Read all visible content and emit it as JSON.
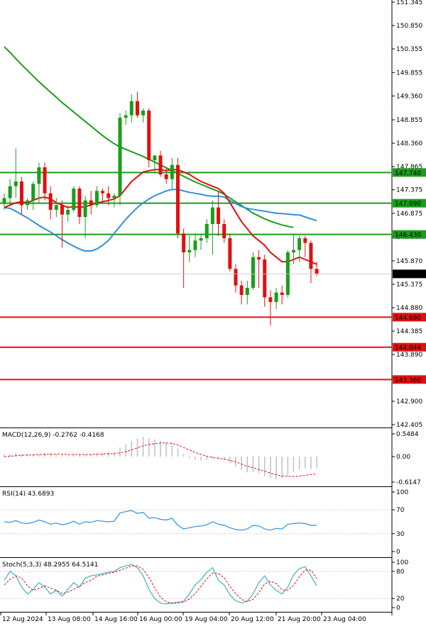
{
  "chart_data": {
    "type": "candlestick",
    "main": {
      "price_axis": [
        "151.345",
        "150.850",
        "150.355",
        "149.855",
        "149.360",
        "148.855",
        "148.360",
        "147.865",
        "147.375",
        "146.875",
        "146.380",
        "145.870",
        "145.375",
        "144.880",
        "144.385",
        "143.890",
        "143.395",
        "142.900",
        "142.405"
      ],
      "ylim": [
        142.405,
        151.345
      ],
      "levels": [
        {
          "value": 147.74,
          "label": "147.740",
          "color": "#1a9e1a"
        },
        {
          "value": 147.09,
          "label": "147.090",
          "color": "#1a9e1a"
        },
        {
          "value": 146.43,
          "label": "146.430",
          "color": "#1a9e1a"
        },
        {
          "value": 144.68,
          "label": "144.680",
          "color": "#e01010"
        },
        {
          "value": 144.044,
          "label": "144.044",
          "color": "#e01010"
        },
        {
          "value": 143.36,
          "label": "143.360",
          "color": "#e01010"
        }
      ],
      "current_price": {
        "value": 145.595,
        "label": "145.595"
      },
      "candles": [
        [
          147.1,
          147.3,
          146.95,
          147.2
        ],
        [
          147.2,
          147.6,
          147.05,
          147.45
        ],
        [
          147.45,
          148.25,
          147.2,
          147.55
        ],
        [
          147.55,
          147.65,
          146.85,
          147.05
        ],
        [
          147.05,
          147.2,
          146.95,
          147.15
        ],
        [
          147.15,
          147.55,
          146.95,
          147.5
        ],
        [
          147.5,
          147.95,
          147.1,
          147.85
        ],
        [
          147.85,
          147.95,
          147.15,
          147.3
        ],
        [
          147.3,
          147.45,
          146.75,
          146.95
        ],
        [
          146.95,
          147.2,
          146.8,
          147.05
        ],
        [
          147.05,
          147.15,
          146.15,
          146.85
        ],
        [
          146.85,
          147.05,
          146.7,
          146.95
        ],
        [
          146.95,
          147.45,
          146.9,
          147.4
        ],
        [
          147.4,
          147.45,
          146.65,
          146.8
        ],
        [
          146.8,
          147.25,
          146.35,
          147.15
        ],
        [
          147.15,
          147.35,
          146.85,
          147.05
        ],
        [
          147.05,
          147.45,
          147.0,
          147.35
        ],
        [
          147.35,
          147.4,
          147.1,
          147.3
        ],
        [
          147.3,
          147.45,
          147.05,
          147.2
        ],
        [
          147.2,
          147.3,
          147.0,
          147.25
        ],
        [
          147.25,
          149.0,
          147.05,
          148.9
        ],
        [
          148.9,
          149.05,
          148.75,
          148.95
        ],
        [
          148.95,
          149.4,
          148.8,
          149.25
        ],
        [
          149.25,
          149.45,
          148.9,
          148.95
        ],
        [
          148.95,
          149.1,
          148.8,
          149.05
        ],
        [
          149.05,
          149.1,
          147.85,
          148.0
        ],
        [
          148.0,
          148.1,
          147.75,
          148.1
        ],
        [
          148.1,
          148.2,
          147.65,
          147.7
        ],
        [
          147.7,
          147.85,
          147.5,
          147.6
        ],
        [
          147.6,
          148.05,
          147.4,
          147.9
        ],
        [
          147.9,
          148.05,
          146.35,
          146.45
        ],
        [
          146.45,
          146.55,
          145.3,
          146.05
        ],
        [
          146.05,
          146.4,
          145.85,
          146.1
        ],
        [
          146.1,
          146.45,
          145.95,
          146.3
        ],
        [
          146.3,
          146.45,
          146.1,
          146.35
        ],
        [
          146.35,
          146.75,
          146.25,
          146.65
        ],
        [
          146.65,
          147.15,
          146.0,
          147.0
        ],
        [
          147.0,
          147.35,
          146.4,
          146.65
        ],
        [
          146.65,
          146.75,
          146.25,
          146.35
        ],
        [
          146.35,
          146.45,
          145.65,
          145.7
        ],
        [
          145.7,
          145.8,
          145.2,
          145.35
        ],
        [
          145.35,
          145.45,
          144.95,
          145.15
        ],
        [
          145.15,
          145.45,
          144.95,
          145.3
        ],
        [
          145.3,
          146.05,
          145.25,
          145.95
        ],
        [
          145.95,
          146.1,
          145.3,
          145.9
        ],
        [
          145.9,
          146.0,
          144.9,
          145.1
        ],
        [
          145.1,
          145.25,
          144.5,
          145.0
        ],
        [
          145.0,
          145.3,
          144.85,
          145.2
        ],
        [
          145.2,
          145.35,
          144.95,
          145.15
        ],
        [
          145.15,
          146.1,
          145.1,
          146.05
        ],
        [
          146.05,
          146.45,
          145.8,
          146.1
        ],
        [
          146.1,
          146.4,
          145.85,
          146.35
        ],
        [
          146.35,
          146.4,
          145.95,
          146.25
        ],
        [
          146.25,
          146.3,
          145.4,
          145.7
        ],
        [
          145.7,
          145.85,
          145.55,
          145.6
        ]
      ],
      "ema_red": [
        147.0,
        147.05,
        147.1,
        147.12,
        147.1,
        147.15,
        147.2,
        147.22,
        147.18,
        147.1,
        147.05,
        147.0,
        147.02,
        147.0,
        147.02,
        147.05,
        147.1,
        147.12,
        147.15,
        147.18,
        147.25,
        147.4,
        147.55,
        147.65,
        147.75,
        147.78,
        147.8,
        147.8,
        147.78,
        147.8,
        147.8,
        147.75,
        147.7,
        147.62,
        147.55,
        147.5,
        147.45,
        147.4,
        147.3,
        147.1,
        146.9,
        146.7,
        146.55,
        146.4,
        146.3,
        146.2,
        146.05,
        145.95,
        145.85,
        145.85,
        145.9,
        145.95,
        145.9,
        145.85,
        145.8
      ],
      "ema_blue": [
        147.0,
        146.98,
        146.92,
        146.85,
        146.78,
        146.7,
        146.62,
        146.55,
        146.48,
        146.4,
        146.32,
        146.25,
        146.18,
        146.12,
        146.08,
        146.08,
        146.12,
        146.2,
        146.3,
        146.45,
        146.6,
        146.75,
        146.88,
        147.0,
        147.1,
        147.18,
        147.25,
        147.3,
        147.35,
        147.38,
        147.38,
        147.35,
        147.32,
        147.3,
        147.28,
        147.25,
        147.24,
        147.24,
        147.22,
        147.15,
        147.08,
        147.02,
        146.98,
        146.96,
        146.94,
        146.92,
        146.9,
        146.88,
        146.87,
        146.86,
        146.85,
        146.84,
        146.8,
        146.76,
        146.72
      ],
      "ema_green": [
        150.4,
        150.28,
        150.15,
        150.02,
        149.9,
        149.78,
        149.66,
        149.55,
        149.44,
        149.33,
        149.22,
        149.12,
        149.02,
        148.92,
        148.82,
        148.72,
        148.62,
        148.52,
        148.43,
        148.35,
        148.28,
        148.23,
        148.18,
        148.13,
        148.08,
        148.02,
        147.96,
        147.9,
        147.84,
        147.78,
        147.72,
        147.66,
        147.6,
        147.54,
        147.49,
        147.44,
        147.39,
        147.34,
        147.28,
        147.2,
        147.12,
        147.04,
        146.96,
        146.88,
        146.82,
        146.76,
        146.71,
        146.67,
        146.63,
        146.6,
        146.58,
        null,
        null,
        null,
        null
      ]
    },
    "macd": {
      "label": "MACD(12,26,9) -0.2762 -0.4168",
      "axis": [
        "0.5484",
        "0.00",
        "-0.6147"
      ],
      "ylim": [
        -0.6147,
        0.5484
      ],
      "histogram": [
        0.05,
        0.06,
        0.08,
        0.07,
        0.06,
        0.05,
        0.06,
        0.09,
        0.08,
        0.06,
        0.04,
        0.03,
        0.05,
        0.04,
        0.05,
        0.06,
        0.08,
        0.09,
        0.1,
        0.11,
        0.22,
        0.3,
        0.38,
        0.44,
        0.48,
        0.44,
        0.42,
        0.38,
        0.34,
        0.33,
        0.2,
        0.06,
        -0.04,
        -0.08,
        -0.09,
        -0.08,
        -0.05,
        -0.04,
        -0.08,
        -0.16,
        -0.24,
        -0.32,
        -0.38,
        -0.38,
        -0.4,
        -0.46,
        -0.52,
        -0.54,
        -0.52,
        -0.46,
        -0.38,
        -0.32,
        -0.28,
        -0.3,
        -0.28
      ],
      "signal": [
        0.0,
        0.01,
        0.02,
        0.03,
        0.04,
        0.04,
        0.05,
        0.05,
        0.06,
        0.06,
        0.06,
        0.05,
        0.05,
        0.05,
        0.05,
        0.05,
        0.06,
        0.06,
        0.07,
        0.07,
        0.09,
        0.12,
        0.16,
        0.21,
        0.26,
        0.29,
        0.31,
        0.33,
        0.33,
        0.32,
        0.28,
        0.22,
        0.16,
        0.1,
        0.05,
        0.01,
        -0.02,
        -0.04,
        -0.06,
        -0.09,
        -0.13,
        -0.18,
        -0.23,
        -0.27,
        -0.31,
        -0.35,
        -0.4,
        -0.44,
        -0.47,
        -0.48,
        -0.48,
        -0.47,
        -0.45,
        -0.43,
        -0.42
      ]
    },
    "rsi": {
      "label": "RSI(14) 43.6893",
      "axis": [
        "100",
        "70",
        "30",
        "0"
      ],
      "ylim": [
        0,
        100
      ],
      "values": [
        50,
        49,
        52,
        48,
        47,
        49,
        53,
        50,
        46,
        48,
        45,
        47,
        51,
        46,
        50,
        49,
        52,
        51,
        50,
        51,
        65,
        67,
        69,
        64,
        66,
        56,
        57,
        54,
        53,
        56,
        44,
        38,
        40,
        42,
        43,
        45,
        50,
        46,
        44,
        40,
        37,
        36,
        38,
        44,
        43,
        38,
        36,
        39,
        38,
        46,
        47,
        48,
        47,
        44,
        44
      ]
    },
    "stoch": {
      "label": "Stoch(5,3,3) 48.2955 64.5141",
      "axis": [
        "100",
        "80",
        "20",
        "0"
      ],
      "ylim": [
        0,
        100
      ],
      "k": [
        60,
        80,
        70,
        45,
        30,
        40,
        55,
        45,
        30,
        38,
        25,
        40,
        55,
        45,
        65,
        70,
        72,
        75,
        78,
        80,
        88,
        92,
        95,
        88,
        70,
        40,
        20,
        10,
        8,
        10,
        12,
        14,
        30,
        50,
        62,
        78,
        88,
        60,
        50,
        28,
        15,
        10,
        14,
        30,
        55,
        70,
        50,
        38,
        30,
        45,
        72,
        86,
        90,
        70,
        48
      ],
      "d": [
        50,
        62,
        70,
        65,
        48,
        38,
        42,
        48,
        43,
        38,
        31,
        34,
        40,
        47,
        55,
        60,
        69,
        72,
        75,
        78,
        82,
        87,
        92,
        92,
        84,
        66,
        43,
        23,
        13,
        9,
        10,
        12,
        19,
        31,
        47,
        63,
        76,
        75,
        66,
        46,
        31,
        18,
        13,
        18,
        33,
        52,
        58,
        53,
        39,
        38,
        49,
        68,
        83,
        82,
        64
      ]
    },
    "time_axis": [
      "12 Aug 2024",
      "13 Aug 08:00",
      "14 Aug 16:00",
      "16 Aug 00:00",
      "19 Aug 04:00",
      "20 Aug 12:00",
      "21 Aug 20:00",
      "23 Aug 04:00"
    ]
  },
  "colors": {
    "bull": "#1a9e1a",
    "bear": "#e01010",
    "ema_red": "#e01010",
    "ema_blue": "#2f8fe0",
    "ema_green": "#1a9e1a",
    "macd_hist": "#c0c0c0",
    "macd_signal": "#e01010",
    "rsi": "#2f8fe0",
    "stoch_k": "#3fb0c0",
    "stoch_d": "#e01010"
  }
}
